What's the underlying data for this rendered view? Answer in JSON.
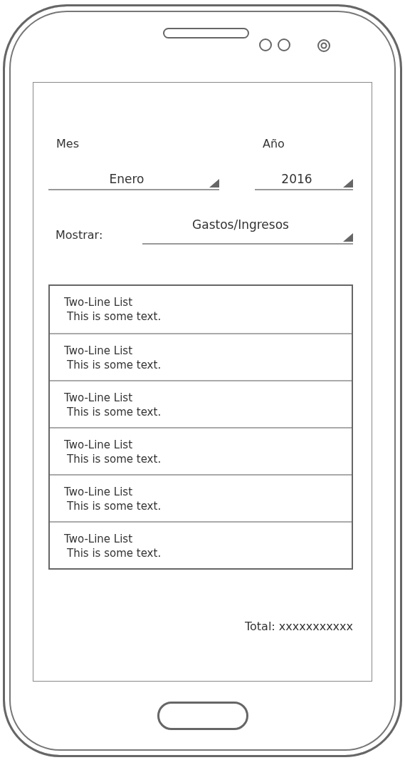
{
  "fields": [
    {
      "label": "Mes",
      "value": "Enero"
    },
    {
      "label": "Año",
      "value": "2016"
    }
  ],
  "show": {
    "label": "Mostrar:",
    "value": "Gastos/Ingresos"
  },
  "list": [
    {
      "title": "Two-Line List",
      "text": "This is some text."
    },
    {
      "title": "Two-Line List",
      "text": "This is some text."
    },
    {
      "title": "Two-Line List",
      "text": "This is some text."
    },
    {
      "title": "Two-Line List",
      "text": "This is some text."
    },
    {
      "title": "Two-Line List",
      "text": "This is some text."
    },
    {
      "title": "Two-Line List",
      "text": "This is some text."
    }
  ],
  "total": "Total: xxxxxxxxxxx"
}
